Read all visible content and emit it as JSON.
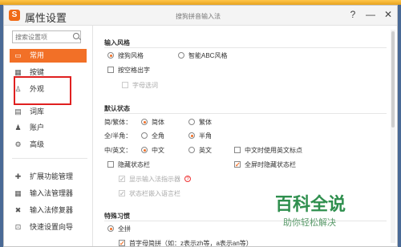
{
  "window": {
    "app_title": "属性设置",
    "subtitle": "搜狗拼音输入法",
    "help_btn": "?",
    "min_btn": "—",
    "close_btn": "✕"
  },
  "sidebar": {
    "search_placeholder": "搜索设置项",
    "items": [
      {
        "label": "常用",
        "icon": "monitor-icon",
        "active": true
      },
      {
        "label": "按键",
        "icon": "keyboard-icon"
      },
      {
        "label": "外观",
        "icon": "shirt-icon"
      },
      {
        "label": "词库",
        "icon": "book-icon"
      },
      {
        "label": "账户",
        "icon": "user-icon"
      },
      {
        "label": "高级",
        "icon": "gear-icon"
      },
      {
        "label": "扩展功能管理",
        "icon": "puzzle-icon"
      },
      {
        "label": "输入法管理器",
        "icon": "grid-icon"
      },
      {
        "label": "输入法修复器",
        "icon": "tools-icon"
      },
      {
        "label": "快速设置向导",
        "icon": "wizard-icon"
      }
    ],
    "highlight_color": "#f27027",
    "annotation_color": "#e02020"
  },
  "main": {
    "input_style": {
      "title": "输入风格",
      "sogou": "搜狗风格",
      "abc": "智能ABC风格",
      "space_commit": "按空格出字",
      "letter_select": "字母选词"
    },
    "default_state": {
      "title": "默认状态",
      "row1_label": "简/繁体：",
      "row1_a": "简体",
      "row1_b": "繁体",
      "row2_label": "全/半角：",
      "row2_a": "全角",
      "row2_b": "半角",
      "row3_label": "中/英文：",
      "row3_a": "中文",
      "row3_b": "英文",
      "row3_c": "中文时使用英文标点",
      "hide_statusbar": "隐藏状态栏",
      "fullscreen_hide": "全屏时隐藏状态栏",
      "show_indicator": "显示输入法指示器",
      "embed_lang": "状态栏嵌入语言栏"
    },
    "special": {
      "title": "特殊习惯",
      "quanpin": "全拼",
      "shouzimu": "首字母简拼（如：z表示zh等，a表示an等）"
    }
  },
  "watermark": {
    "big": "百科全说",
    "small": "助你轻松解决"
  }
}
